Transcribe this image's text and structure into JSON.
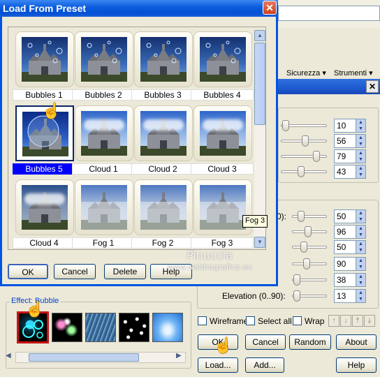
{
  "dialog": {
    "title": "Load From Preset",
    "close_label": "✕",
    "presets": [
      {
        "label": "Bubbles 1",
        "kind": "bubbles"
      },
      {
        "label": "Bubbles 2",
        "kind": "bubbles"
      },
      {
        "label": "Bubbles 3",
        "kind": "bubbles"
      },
      {
        "label": "Bubbles 4",
        "kind": "bubbles"
      },
      {
        "label": "Bubbles 5",
        "kind": "bubble-big",
        "selected": true
      },
      {
        "label": "Cloud 1",
        "kind": "cloud"
      },
      {
        "label": "Cloud 2",
        "kind": "cloud"
      },
      {
        "label": "Cloud 3",
        "kind": "cloud"
      },
      {
        "label": "Cloud 4",
        "kind": "cloud-dark"
      },
      {
        "label": "Fog 1",
        "kind": "fog"
      },
      {
        "label": "Fog 2",
        "kind": "fog"
      },
      {
        "label": "Fog 3",
        "kind": "fog"
      }
    ],
    "tooltip": "Fog 3",
    "buttons": {
      "ok": "OK",
      "cancel": "Cancel",
      "delete": "Delete",
      "help": "Help"
    }
  },
  "watermark": {
    "name": "Pinuccia",
    "url": "www.waldrografica.eu"
  },
  "background": {
    "menu": {
      "sicurezza": "Sicurezza ▾",
      "strumenti": "Strumenti ▾"
    },
    "panel_close": "✕",
    "sliders_top": [
      "10",
      "56",
      "79",
      "43"
    ],
    "sliders_bottom": [
      "50",
      "96",
      "50",
      "90",
      "38",
      "13"
    ],
    "bottom_row_labels": {
      "partial": "0):",
      "elevation": "Elevation (0..90):"
    },
    "checkboxes": {
      "wireframe": "Wireframe",
      "select_all": "Select all",
      "wrap": "Wrap"
    },
    "buttons": {
      "ok": "OK",
      "cancel": "Cancel",
      "random": "Random",
      "about": "About",
      "load": "Load...",
      "add": "Add...",
      "help": "Help"
    },
    "effect_label": "Effect: Bubble"
  },
  "colors": {
    "titlebar": "#0a5bdc",
    "selected_label": "#0000ff",
    "accent_pointer": "#f3c400"
  }
}
